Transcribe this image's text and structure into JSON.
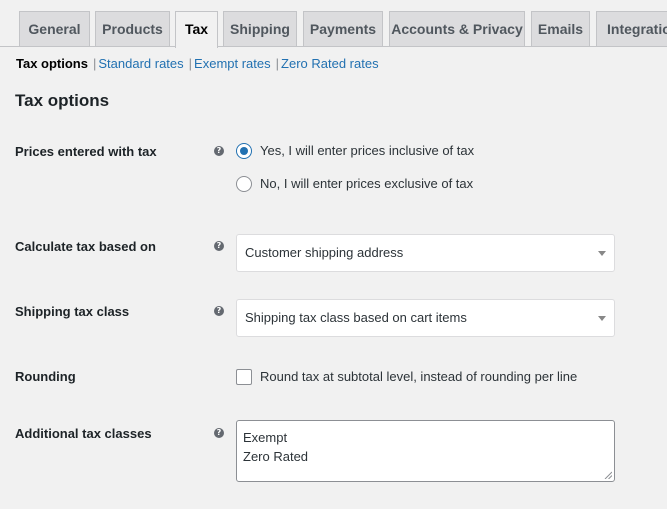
{
  "tabs": [
    {
      "label": "General",
      "active": false
    },
    {
      "label": "Products",
      "active": false
    },
    {
      "label": "Tax",
      "active": true
    },
    {
      "label": "Shipping",
      "active": false
    },
    {
      "label": "Payments",
      "active": false
    },
    {
      "label": "Accounts & Privacy",
      "active": false
    },
    {
      "label": "Emails",
      "active": false
    },
    {
      "label": "Integration",
      "active": false
    }
  ],
  "subnav": {
    "current": "Tax options",
    "links": [
      "Standard rates",
      "Exempt rates",
      "Zero Rated rates"
    ],
    "separator": "|"
  },
  "section": {
    "title": "Tax options"
  },
  "help_icon_glyph": "?",
  "fields": {
    "prices_entered_with_tax": {
      "label": "Prices entered with tax",
      "options": [
        {
          "label": "Yes, I will enter prices inclusive of tax",
          "checked": true
        },
        {
          "label": "No, I will enter prices exclusive of tax",
          "checked": false
        }
      ]
    },
    "calculate_tax_based_on": {
      "label": "Calculate tax based on",
      "value": "Customer shipping address"
    },
    "shipping_tax_class": {
      "label": "Shipping tax class",
      "value": "Shipping tax class based on cart items"
    },
    "rounding": {
      "label": "Rounding",
      "checkbox_label": "Round tax at subtotal level, instead of rounding per line",
      "checked": false
    },
    "additional_tax_classes": {
      "label": "Additional tax classes",
      "lines": [
        "Exempt",
        "Zero Rated"
      ]
    }
  },
  "colors": {
    "link": "#2271b1",
    "radio_checked": "#2271b1",
    "background": "#f1f1f1",
    "tab_inactive": "#dcdcde"
  },
  "icons": {
    "help": "help-icon",
    "dropdown": "caret-down-icon",
    "resize": "resize-grip-icon"
  }
}
